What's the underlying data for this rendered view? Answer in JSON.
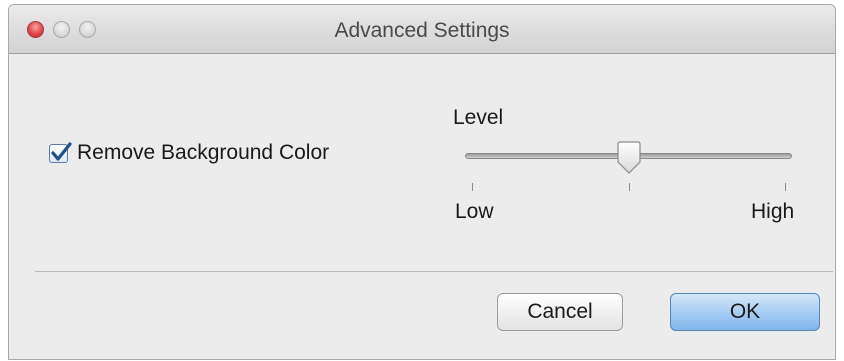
{
  "window": {
    "title": "Advanced Settings",
    "controls": [
      "close",
      "minimize",
      "zoom"
    ]
  },
  "background_option": {
    "label": "Remove Background Color",
    "checked": true
  },
  "level_slider": {
    "label": "Level",
    "min_label": "Low",
    "max_label": "High",
    "value_fraction": 0.5
  },
  "buttons": {
    "cancel_label": "Cancel",
    "ok_label": "OK"
  },
  "colors": {
    "close_button": "#e1474c",
    "default_button": "#a7cdf3",
    "checkmark": "#1c4f8c"
  }
}
